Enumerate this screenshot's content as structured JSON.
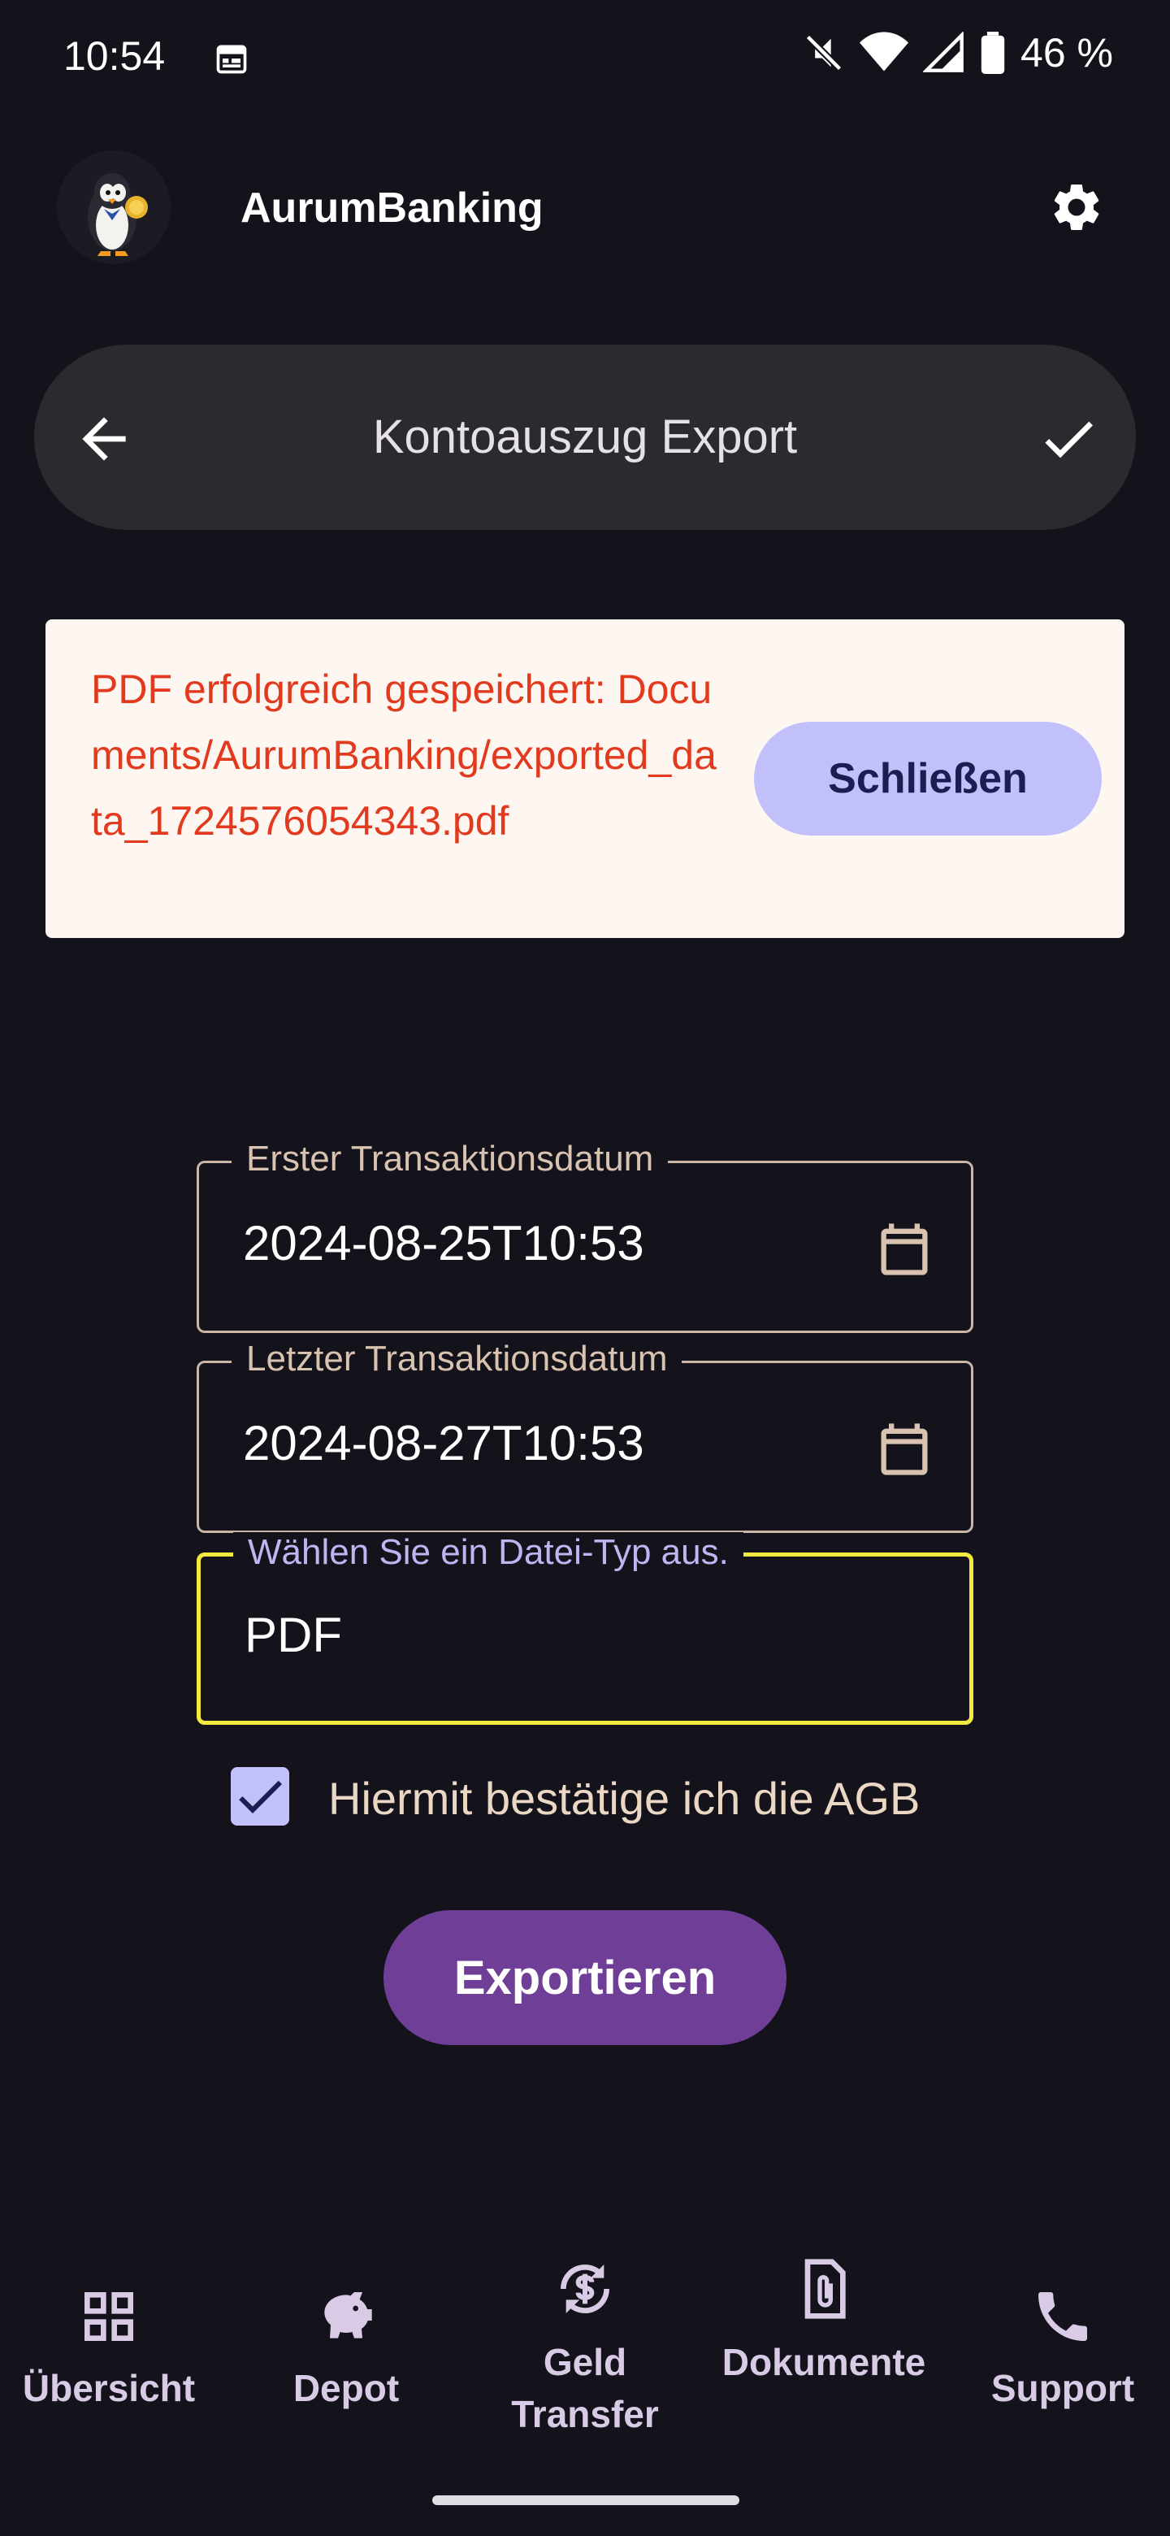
{
  "status_bar": {
    "time": "10:54",
    "battery": "46 %",
    "icons": [
      "calendar-icon",
      "mute-icon",
      "wifi-icon",
      "signal-icon",
      "battery-icon"
    ]
  },
  "app": {
    "title": "AurumBanking",
    "logo": "penguin-logo",
    "settings_icon": "gear-icon"
  },
  "header": {
    "title": "Kontoauszug Export",
    "back_icon": "arrow-back-icon",
    "confirm_icon": "check-icon"
  },
  "snackbar": {
    "message": "PDF erfolgreich gespeichert: Documents/AurumBanking/exported_data_1724576054343.pdf",
    "close_label": "Schließen",
    "text_color": "#e23a1f"
  },
  "form": {
    "first_date": {
      "label": "Erster Transaktionsdatum",
      "value": "2024-08-25T10:53"
    },
    "last_date": {
      "label": "Letzter Transaktionsdatum",
      "value": "2024-08-27T10:53"
    },
    "file_type": {
      "label": "Wählen Sie ein Datei-Typ aus.",
      "value": "PDF"
    },
    "agb": {
      "label": "Hiermit bestätige ich die AGB",
      "checked": true
    },
    "export_label": "Exportieren"
  },
  "nav": {
    "items": [
      {
        "label": "Übersicht",
        "icon": "grid-icon"
      },
      {
        "label": "Depot",
        "icon": "piggy-bank-icon"
      },
      {
        "label": "Geld Transfer",
        "icon": "currency-exchange-icon"
      },
      {
        "label": "Dokumente",
        "icon": "document-icon"
      },
      {
        "label": "Support",
        "icon": "phone-icon"
      }
    ]
  },
  "colors": {
    "background": "#14121b",
    "accent": "#6f3f98",
    "active_border": "#f1ea3f"
  }
}
